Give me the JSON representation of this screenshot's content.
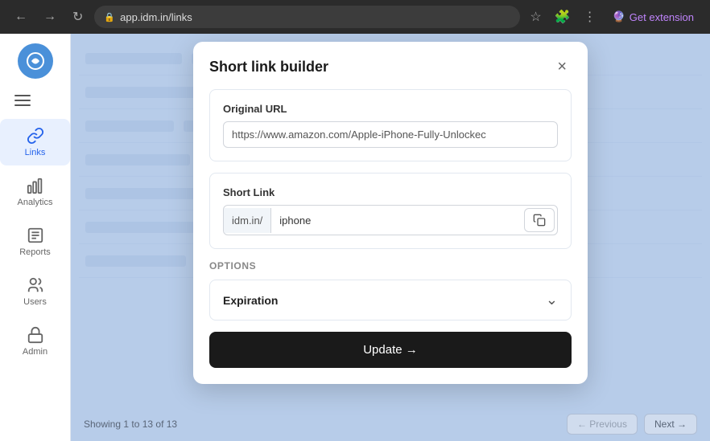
{
  "browser": {
    "url": "app.idm.in/links",
    "back_label": "←",
    "forward_label": "→",
    "refresh_label": "↻",
    "bookmark_label": "☆",
    "extension_label": "🧩",
    "get_extension_label": "Get extension"
  },
  "sidebar": {
    "hamburger_label": "☰",
    "items": [
      {
        "id": "links",
        "label": "Links",
        "active": true
      },
      {
        "id": "analytics",
        "label": "Analytics",
        "active": false
      },
      {
        "id": "reports",
        "label": "Reports",
        "active": false
      },
      {
        "id": "users",
        "label": "Users",
        "active": false
      },
      {
        "id": "admin",
        "label": "Admin",
        "active": false
      }
    ]
  },
  "modal": {
    "title": "Short link builder",
    "close_label": "×",
    "original_url_label": "Original URL",
    "original_url_value": "https://www.amazon.com/Apple-iPhone-Fully-Unlockec",
    "original_url_placeholder": "https://www.amazon.com/Apple-iPhone-Fully-Unlockec",
    "short_link_label": "Short Link",
    "short_link_prefix": "idm.in/",
    "short_link_value": "iphone",
    "options_label": "OPTIONS",
    "expiration_label": "Expiration",
    "update_label": "Update  →",
    "copy_label": "copy"
  },
  "table_footer": {
    "showing_text": "Showing 1 to 13 of 13",
    "previous_label": "← Previous",
    "next_label": "Next →"
  }
}
